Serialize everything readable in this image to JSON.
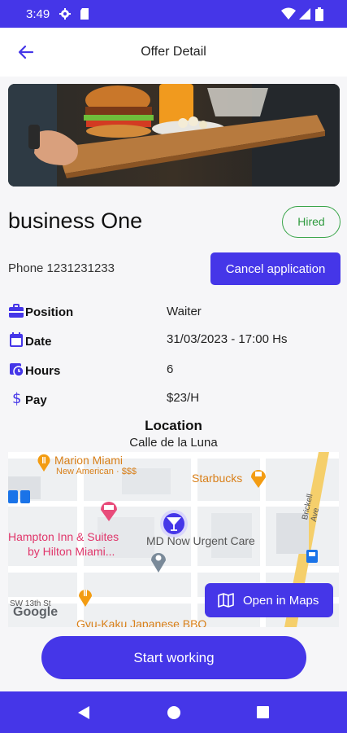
{
  "status_bar": {
    "time": "3:49"
  },
  "header": {
    "title": "Offer Detail"
  },
  "business": {
    "name": "business One",
    "status": "Hired"
  },
  "contact": {
    "phone_prefix": "Phone",
    "phone_number": "1231231233",
    "cancel_label": "Cancel application"
  },
  "details": [
    {
      "label": "Position",
      "value": "Waiter",
      "icon": "briefcase-icon"
    },
    {
      "label": "Date",
      "value": "31/03/2023 - 17:00 Hs",
      "icon": "calendar-icon"
    },
    {
      "label": "Hours",
      "value": "6",
      "icon": "clock-icon"
    },
    {
      "label": "Pay",
      "value": "$23/H",
      "icon": "dollar-icon"
    }
  ],
  "location": {
    "title": "Location",
    "address": "Calle de la Luna",
    "map_labels": {
      "marion": "Marion Miami",
      "marion_sub": "New American · $$$",
      "starbucks": "Starbucks",
      "hampton1": "Hampton Inn & Suites",
      "hampton2": "by Hilton Miami...",
      "mdnow": "MD Now Urgent Care",
      "street1": "SW 13th St",
      "street2": "Brickell Ave",
      "gyukaku": "Gyu-Kaku Japanese BBQ",
      "google": "Google"
    },
    "open_maps_label": "Open in Maps"
  },
  "actions": {
    "start_label": "Start working"
  },
  "colors": {
    "primary": "#4536e8",
    "hired": "#2e9a3e"
  }
}
